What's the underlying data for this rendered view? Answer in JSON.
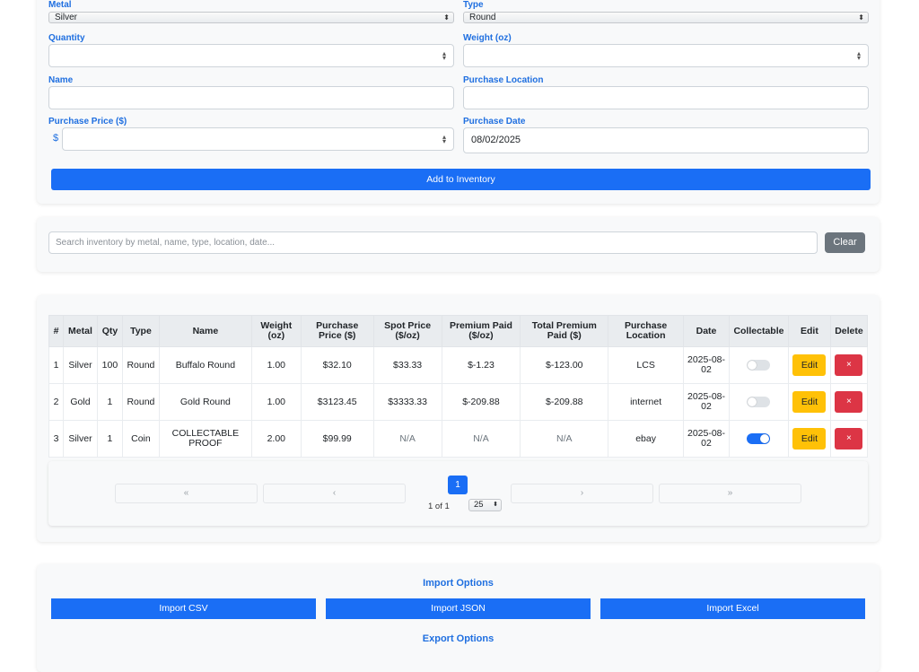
{
  "form": {
    "metal_label": "Metal",
    "metal_value": "Silver",
    "type_label": "Type",
    "type_value": "Round",
    "quantity_label": "Quantity",
    "weight_label": "Weight (oz)",
    "name_label": "Name",
    "purchase_location_label": "Purchase Location",
    "purchase_price_label": "Purchase Price ($)",
    "currency_symbol": "$",
    "purchase_date_label": "Purchase Date",
    "purchase_date_value": "08/02/2025",
    "add_button": "Add to Inventory"
  },
  "search": {
    "placeholder": "Search inventory by metal, name, type, location, date...",
    "clear_button": "Clear"
  },
  "table": {
    "headers": [
      "#",
      "Metal",
      "Qty",
      "Type",
      "Name",
      "Weight (oz)",
      "Purchase Price ($)",
      "Spot Price ($/oz)",
      "Premium Paid ($/oz)",
      "Total Premium Paid ($)",
      "Purchase Location",
      "Date",
      "Collectable",
      "Edit",
      "Delete"
    ],
    "rows": [
      {
        "num": "1",
        "metal": "Silver",
        "qty": "100",
        "type": "Round",
        "name": "Buffalo Round",
        "weight": "1.00",
        "price": "$32.10",
        "spot": "$33.33",
        "premium": "$-1.23",
        "total_premium": "$-123.00",
        "location": "LCS",
        "date": "2025-08-02",
        "collectable": false,
        "edit": "Edit",
        "delete": "×"
      },
      {
        "num": "2",
        "metal": "Gold",
        "qty": "1",
        "type": "Round",
        "name": "Gold Round",
        "weight": "1.00",
        "price": "$3123.45",
        "spot": "$3333.33",
        "premium": "$-209.88",
        "total_premium": "$-209.88",
        "location": "internet",
        "date": "2025-08-02",
        "collectable": false,
        "edit": "Edit",
        "delete": "×"
      },
      {
        "num": "3",
        "metal": "Silver",
        "qty": "1",
        "type": "Coin",
        "name": "COLLECTABLE PROOF",
        "weight": "2.00",
        "price": "$99.99",
        "spot": "N/A",
        "premium": "N/A",
        "total_premium": "N/A",
        "location": "ebay",
        "date": "2025-08-02",
        "collectable": true,
        "edit": "Edit",
        "delete": "×"
      }
    ]
  },
  "pagination": {
    "first": "«",
    "prev": "‹",
    "next": "›",
    "last": "»",
    "current_page": "1",
    "page_info": "1 of 1",
    "page_size": "25"
  },
  "import_export": {
    "import_title": "Import Options",
    "import_csv": "Import CSV",
    "import_json": "Import JSON",
    "import_excel": "Import Excel",
    "export_title": "Export Options"
  },
  "colors": {
    "primary": "#1a6ef5",
    "label_blue": "#1f6fe0",
    "warning": "#ffc107",
    "danger": "#dc3545",
    "secondary": "#6c757d"
  }
}
